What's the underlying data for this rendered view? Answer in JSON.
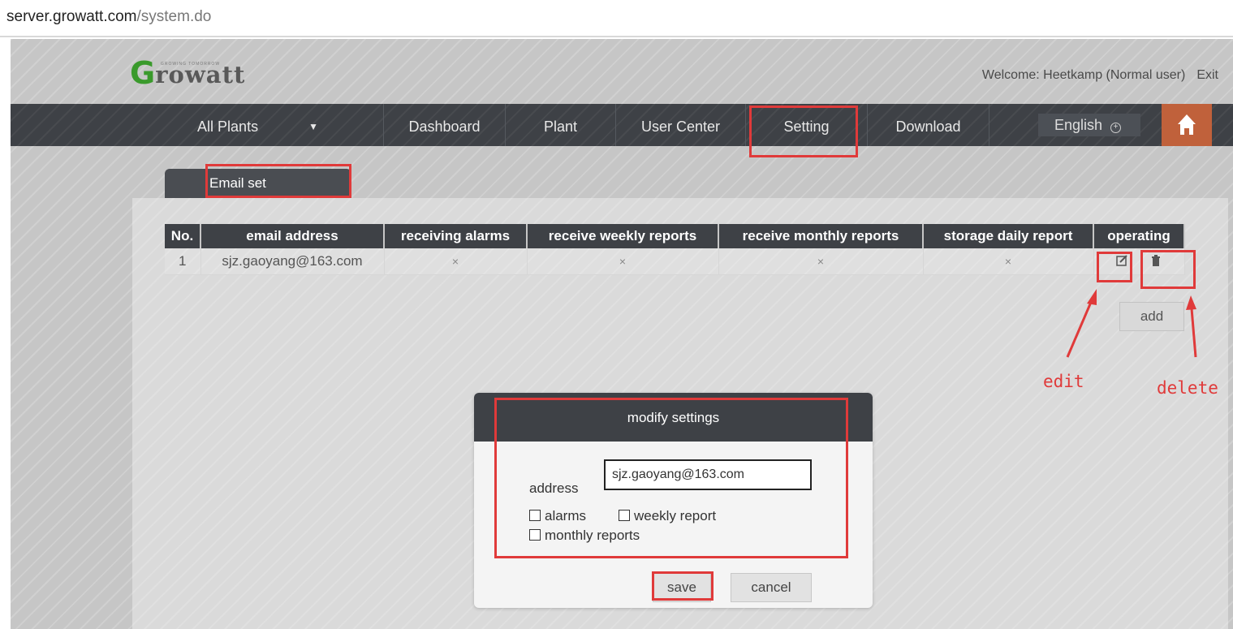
{
  "browser": {
    "url_host": "server.growatt.com",
    "url_path": "/system.do"
  },
  "header": {
    "logo_letter": "G",
    "logo_rest": "rowatt",
    "logo_tagline": "GROWING TOMORROW",
    "welcome_text": "Welcome:  Heetkamp (Normal user)",
    "exit_label": "Exit"
  },
  "nav": {
    "items": [
      {
        "label": "All Plants"
      },
      {
        "label": "Dashboard"
      },
      {
        "label": "Plant"
      },
      {
        "label": "User Center"
      },
      {
        "label": "Setting"
      },
      {
        "label": "Download"
      }
    ],
    "language": "English"
  },
  "tab": {
    "label": "Email set"
  },
  "table": {
    "headers": [
      "No.",
      "email address",
      "receiving alarms",
      "receive weekly reports",
      "receive monthly reports",
      "storage daily report",
      "operating"
    ],
    "rows": [
      {
        "no": "1",
        "email": "sjz.gaoyang@163.com",
        "alarms": "×",
        "weekly": "×",
        "monthly": "×",
        "storage": "×"
      }
    ]
  },
  "add_label": "add",
  "annotations": {
    "edit": "edit",
    "delete": "delete"
  },
  "dialog": {
    "title": "modify settings",
    "address_label": "address",
    "address_value": "sjz.gaoyang@163.com",
    "cb_alarms": "alarms",
    "cb_weekly": "weekly report",
    "cb_monthly": "monthly reports",
    "save_label": "save",
    "cancel_label": "cancel"
  },
  "colors": {
    "annotation_red": "#e03a3a",
    "nav_bg": "#3e4146",
    "brand_green": "#3a9a2c",
    "home_orange": "#c0613b"
  }
}
